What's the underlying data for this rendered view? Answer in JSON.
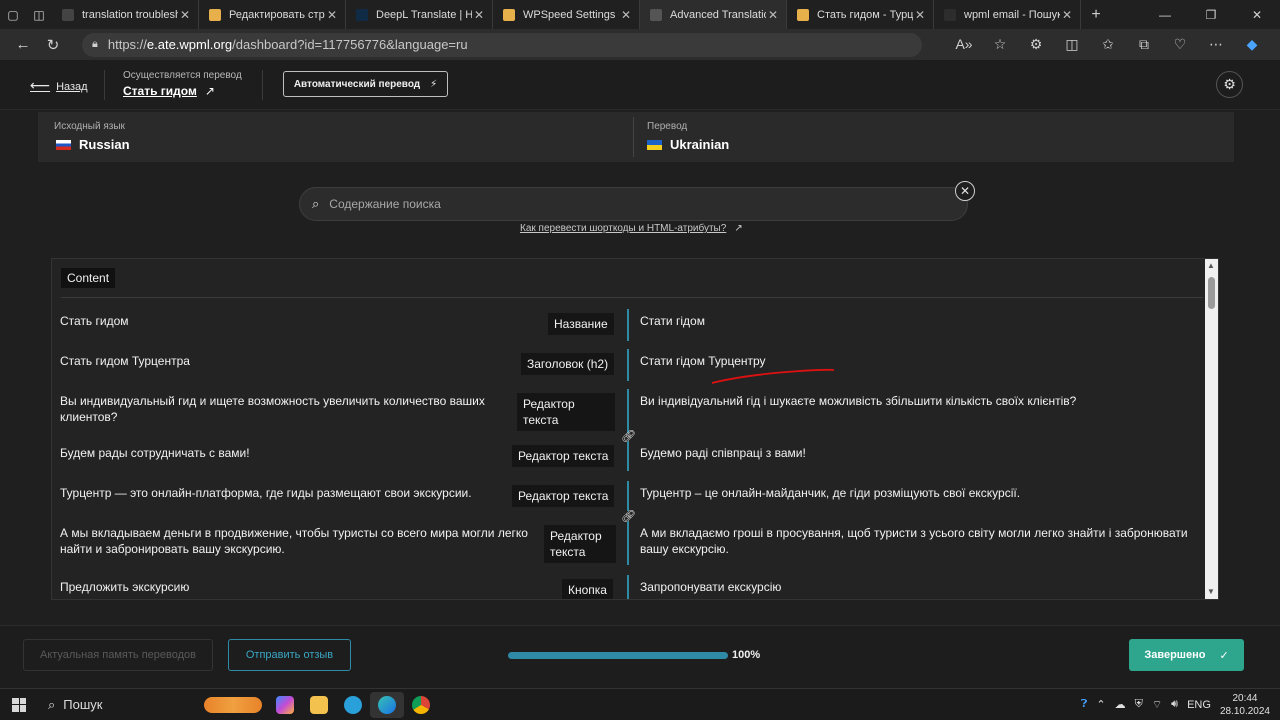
{
  "browser": {
    "tabs": [
      {
        "title": "translation troubleshooting",
        "favicon_color": "#444444",
        "active": false
      },
      {
        "title": "Редактировать страницу",
        "favicon_color": "#e8b04a",
        "active": false
      },
      {
        "title": "DeepL Translate | Найти",
        "favicon_color": "#0f2b46",
        "active": false
      },
      {
        "title": "WPSpeed Settings ‹ Т",
        "favicon_color": "#e8b04a",
        "active": false
      },
      {
        "title": "Advanced Translation",
        "favicon_color": "#555555",
        "active": true
      },
      {
        "title": "Стать гидом - Турцентр",
        "favicon_color": "#e8b04a",
        "active": false
      },
      {
        "title": "wpml email - Пошук",
        "favicon_color": "#2d2d2d",
        "active": false
      }
    ],
    "url_scheme": "https://",
    "url_host": "e.ate.wpml.org",
    "url_path": "/dashboard?id=117756776&language=ru"
  },
  "header": {
    "back_label": "Назад",
    "translating_label": "Осуществляется перевод",
    "page_title": "Стать гидом",
    "auto_translate_label": "Автоматический перевод"
  },
  "languages": {
    "source_label": "Исходный язык",
    "source_name": "Russian",
    "target_label": "Перевод",
    "target_name": "Ukrainian"
  },
  "search": {
    "placeholder": "Содержание поиска",
    "help_link": "Как перевести шорткоды и HTML-атрибуты?"
  },
  "table": {
    "section_label": "Content",
    "rows": [
      {
        "source": "Стать гидом",
        "type": "Название",
        "target": "Стати гідом"
      },
      {
        "source": "Стать гидом Турцентра",
        "type": "Заголовок (h2)",
        "target": "Стати гідом Турцентру"
      },
      {
        "source": "Вы индивидуальный гид и ищете возможность увеличить количество ваших клиентов?",
        "type": "Редактор текста",
        "target": "Ви індивідуальний гід і шукаєте можливість збільшити кількість своїх клієнтів?"
      },
      {
        "source": "Будем рады сотрудничать с вами!",
        "type": "Редактор текста",
        "target": "Будемо раді співпраці з вами!"
      },
      {
        "source": "Турцентр — это онлайн-платформа, где гиды размещают свои экскурсии.",
        "type": "Редактор текста",
        "target": "Турцентр – це онлайн-майданчик, де гіди розміщують свої екскурсії."
      },
      {
        "source": "А мы вкладываем деньги в продвижение, чтобы туристы со всего мира могли легко найти и забронировать вашу экскурсию.",
        "type": "Редактор текста",
        "target": "А ми вкладаємо гроші в просування, щоб туристи з усього світу могли легко знайти і забронювати вашу екскурсію."
      },
      {
        "source": "Предложить экскурсию",
        "type": "Кнопка",
        "target": "Запропонувати екскурсію"
      }
    ]
  },
  "footer": {
    "tm_button": "Актуальная память переводов",
    "feedback_button": "Отправить отзыв",
    "progress": 1.0,
    "progress_label": "100%",
    "done_button": "Завершено"
  },
  "taskbar": {
    "search_label": "Пошук",
    "lang": "ENG",
    "time": "20:44",
    "date": "28.10.2024"
  },
  "colors": {
    "accent": "#2f8aa5",
    "done": "#2ea68e"
  }
}
